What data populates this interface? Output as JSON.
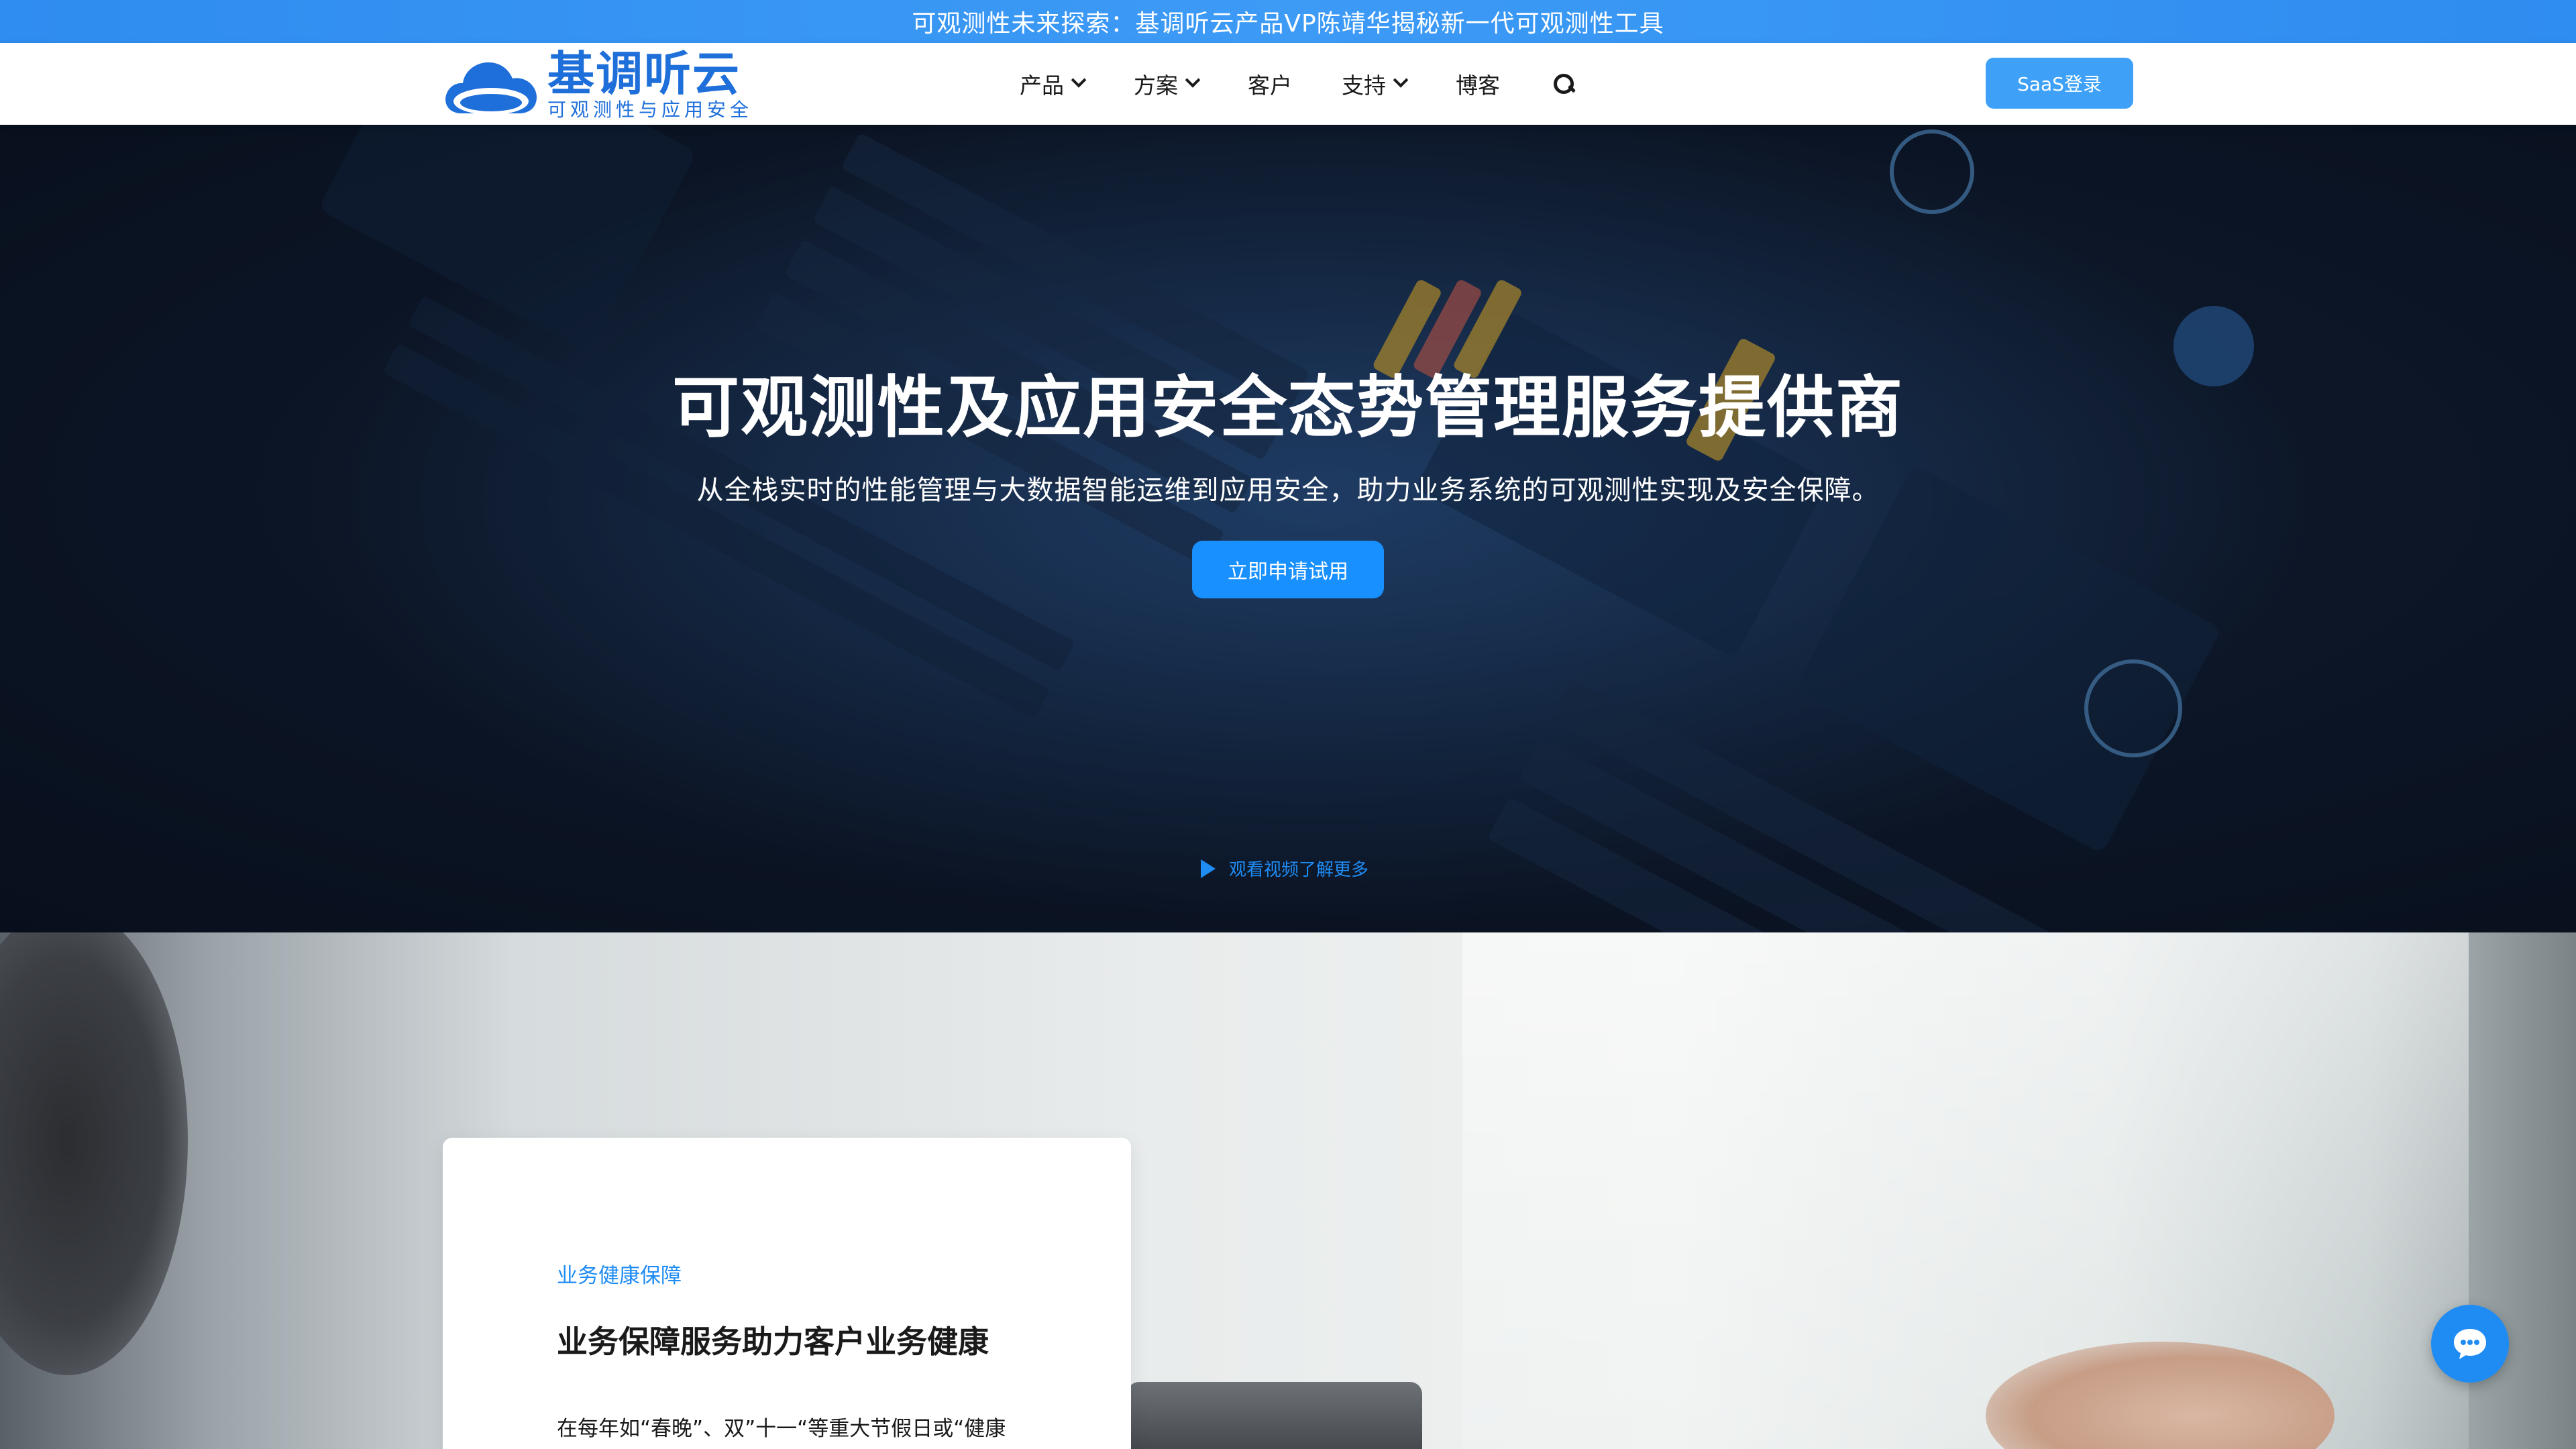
{
  "announcement": {
    "text": "可观测性未来探索：基调听云产品VP陈靖华揭秘新一代可观测性工具"
  },
  "header": {
    "logo": {
      "name": "基调听云",
      "tagline": "可观测性与应用安全"
    },
    "nav": [
      {
        "label": "产品",
        "has_dropdown": true
      },
      {
        "label": "方案",
        "has_dropdown": true
      },
      {
        "label": "客户",
        "has_dropdown": false
      },
      {
        "label": "支持",
        "has_dropdown": true
      },
      {
        "label": "博客",
        "has_dropdown": false
      }
    ],
    "search_icon": "search-icon",
    "saas_login_label": "SaaS登录"
  },
  "hero": {
    "title": "可观测性及应用安全态势管理服务提供商",
    "subtitle": "从全栈实时的性能管理与大数据智能运维到应用安全，助力业务系统的可观测性实现及安全保障。",
    "cta_label": "立即申请试用",
    "video_link_label": "观看视频了解更多"
  },
  "feature_card": {
    "tag": "业务健康保障",
    "title": "业务保障服务助力客户业务健康",
    "body": "在每年如“春晚”、双”十一“等重大节假日或“健康"
  },
  "chat_widget": {
    "icon": "chat-icon"
  },
  "colors": {
    "accent": "#1f8cf4",
    "announce_bar": "#2f8cf0",
    "saas_button": "#3ea1f7",
    "cta_button": "#1890ff",
    "logo_blue": "#1e6fd9"
  }
}
